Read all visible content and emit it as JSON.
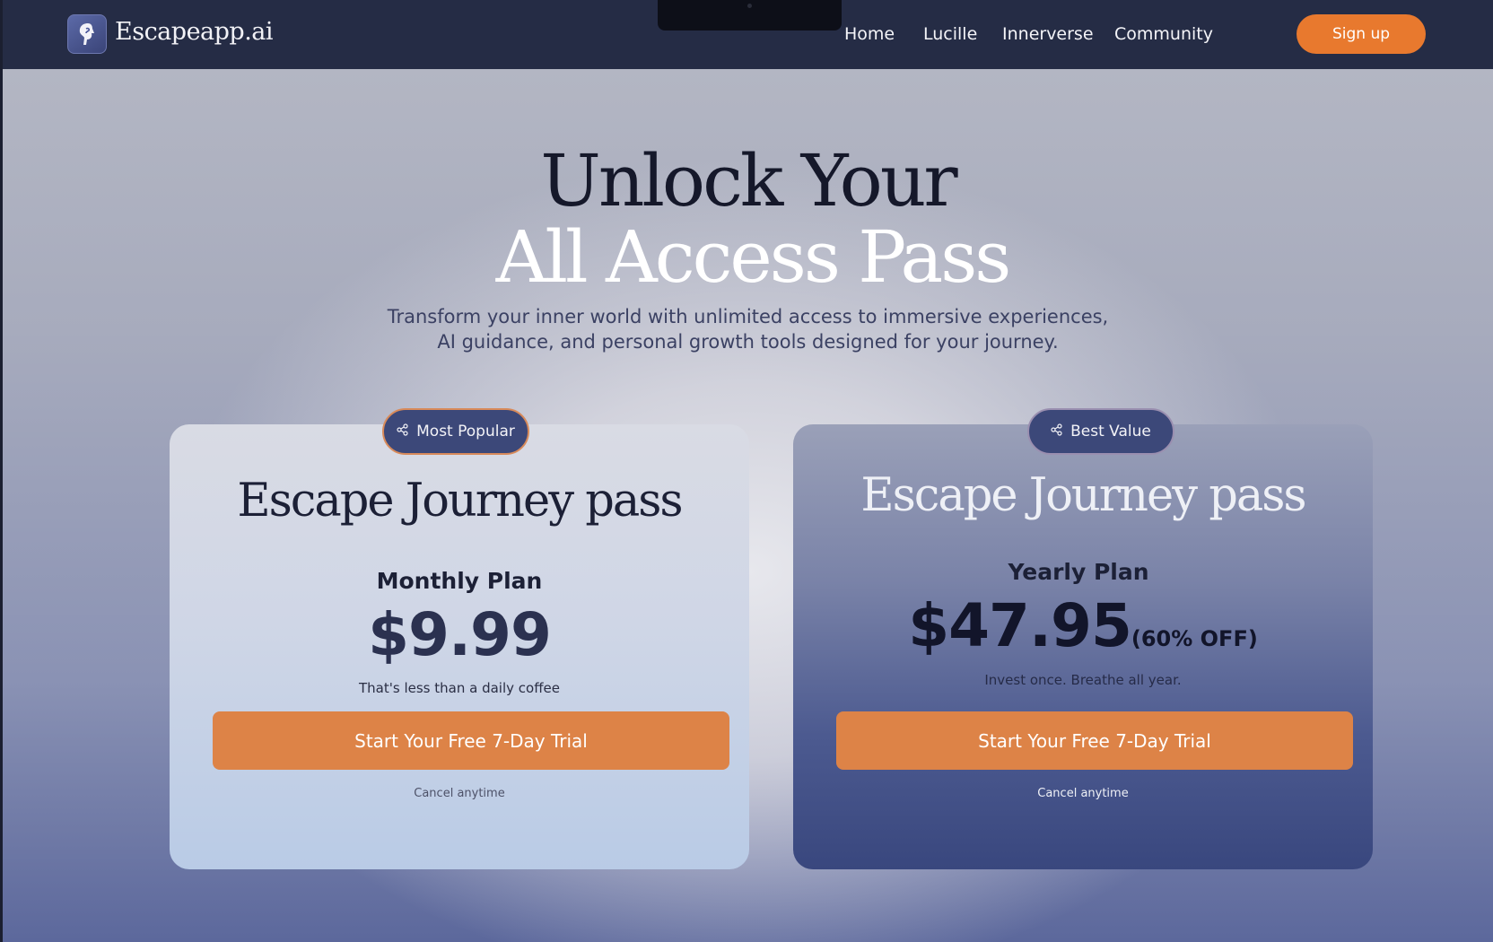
{
  "header": {
    "logo_text": "Escapeapp.ai",
    "nav": [
      "Home",
      "Lucille",
      "Innerverse",
      "Community"
    ],
    "signup_label": "Sign up"
  },
  "hero": {
    "title_line1": "Unlock Your",
    "title_line2": "All Access Pass",
    "subtitle_line1": "Transform your inner world with unlimited access to immersive experiences,",
    "subtitle_line2": "AI guidance, and personal growth tools designed for your journey."
  },
  "plans": [
    {
      "badge": "Most Popular",
      "title": "Escape Journey pass",
      "plan_name": "Monthly Plan",
      "price": "$9.99",
      "discount": "",
      "note": "That's less than a daily coffee",
      "cta": "Start Your Free 7-Day Trial",
      "cancel": "Cancel anytime"
    },
    {
      "badge": "Best Value",
      "title": "Escape Journey pass",
      "plan_name": "Yearly Plan",
      "price": "$47.95",
      "discount": "(60% OFF)",
      "note": "Invest once. Breathe all year.",
      "cta": "Start Your Free 7-Day Trial",
      "cancel": "Cancel anytime"
    }
  ],
  "colors": {
    "header_bg": "#252c45",
    "accent_orange": "#e8792e",
    "badge_bg": "#3c4879",
    "dark_text": "#15182a"
  },
  "icons": {
    "logo": "face-profile-icon",
    "badge": "share-nodes-icon"
  }
}
